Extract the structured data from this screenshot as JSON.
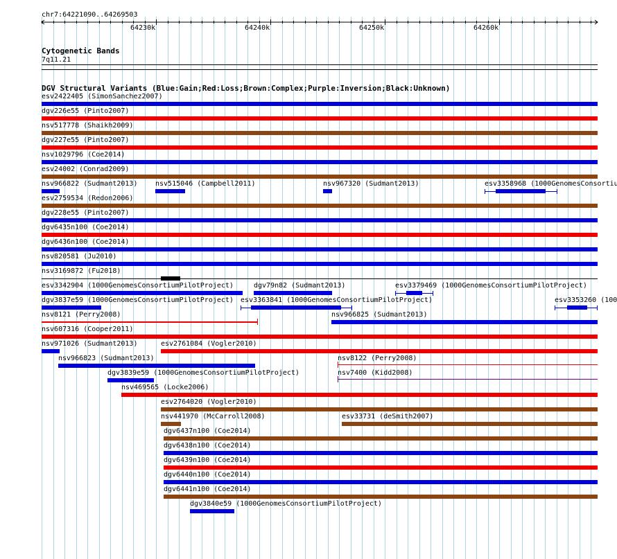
{
  "ruler": {
    "region": "chr7:64221090..64269503",
    "ticks": [
      "64230k",
      "64240k",
      "64250k",
      "64260k"
    ]
  },
  "cytoband_track": {
    "title": "Cytogenetic Bands",
    "band": "7q11.21"
  },
  "dgv_track": {
    "title": "DGV Structural Variants (Blue:Gain;Red:Loss;Brown:Complex;Purple:Inversion;Black:Unknown)"
  },
  "colors": {
    "gain": "#0000dd",
    "loss": "#ee0000",
    "complex": "#8b4513",
    "inversion": "#6a0080",
    "unknown": "#000000",
    "grid": "#a8d8e8"
  },
  "variants": [
    {
      "label": "esv2422405 (SimonSanchez2007)",
      "color": "gain"
    },
    {
      "label": "dgv226e55 (Pinto2007)",
      "color": "loss"
    },
    {
      "label": "nsv517778 (Shaikh2009)",
      "color": "complex"
    },
    {
      "label": "dgv227e55 (Pinto2007)",
      "color": "loss"
    },
    {
      "label": "nsv1029796 (Coe2014)",
      "color": "gain"
    },
    {
      "label": "esv24002 (Conrad2009)",
      "color": "complex"
    },
    {
      "label": "nsv966822 (Sudmant2013)",
      "color": "gain"
    },
    {
      "label": "nsv515046 (Campbell2011)",
      "color": "gain"
    },
    {
      "label": "nsv967320 (Sudmant2013)",
      "color": "gain"
    },
    {
      "label": "esv3358968 (1000GenomesConsortiu",
      "color": "gain"
    },
    {
      "label": "esv2759534 (Redon2006)",
      "color": "complex"
    },
    {
      "label": "dgv228e55 (Pinto2007)",
      "color": "gain"
    },
    {
      "label": "dgv6435n100 (Coe2014)",
      "color": "loss"
    },
    {
      "label": "dgv6436n100 (Coe2014)",
      "color": "gain"
    },
    {
      "label": "nsv820581 (Ju2010)",
      "color": "gain"
    },
    {
      "label": "nsv3169872 (Fu2018)",
      "color": "unknown"
    },
    {
      "label": "esv3342904 (1000GenomesConsortiumPilotProject)",
      "color": "gain"
    },
    {
      "label": "dgv79n82 (Sudmant2013)",
      "color": "gain"
    },
    {
      "label": "esv3379469 (1000GenomesConsortiumPilotProject)",
      "color": "gain"
    },
    {
      "label": "dgv3837e59 (1000GenomesConsortiumPilotProject)",
      "color": "gain"
    },
    {
      "label": "esv3363841 (1000GenomesConsortiumPilotProject)",
      "color": "gain"
    },
    {
      "label": "esv3353260 (100",
      "color": "gain"
    },
    {
      "label": "nsv8121 (Perry2008)",
      "color": "loss"
    },
    {
      "label": "nsv966825 (Sudmant2013)",
      "color": "gain"
    },
    {
      "label": "nsv607316 (Cooper2011)",
      "color": "loss"
    },
    {
      "label": "nsv971026 (Sudmant2013)",
      "color": "gain"
    },
    {
      "label": "esv2761084 (Vogler2010)",
      "color": "loss"
    },
    {
      "label": "nsv966823 (Sudmant2013)",
      "color": "gain"
    },
    {
      "label": "nsv8122 (Perry2008)",
      "color": "loss"
    },
    {
      "label": "dgv3839e59 (1000GenomesConsortiumPilotProject)",
      "color": "gain"
    },
    {
      "label": "nsv7400 (Kidd2008)",
      "color": "inversion"
    },
    {
      "label": "nsv469565 (Locke2006)",
      "color": "loss"
    },
    {
      "label": "esv2764020 (Vogler2010)",
      "color": "complex"
    },
    {
      "label": "nsv441970 (McCarroll2008)",
      "color": "complex"
    },
    {
      "label": "esv33731 (deSmith2007)",
      "color": "complex"
    },
    {
      "label": "dgv6437n100 (Coe2014)",
      "color": "complex"
    },
    {
      "label": "dgv6438n100 (Coe2014)",
      "color": "gain"
    },
    {
      "label": "dgv6439n100 (Coe2014)",
      "color": "loss"
    },
    {
      "label": "dgv6440n100 (Coe2014)",
      "color": "gain"
    },
    {
      "label": "dgv6441n100 (Coe2014)",
      "color": "complex"
    },
    {
      "label": "dgv3840e59 (1000GenomesConsortiumPilotProject)",
      "color": "gain"
    }
  ]
}
